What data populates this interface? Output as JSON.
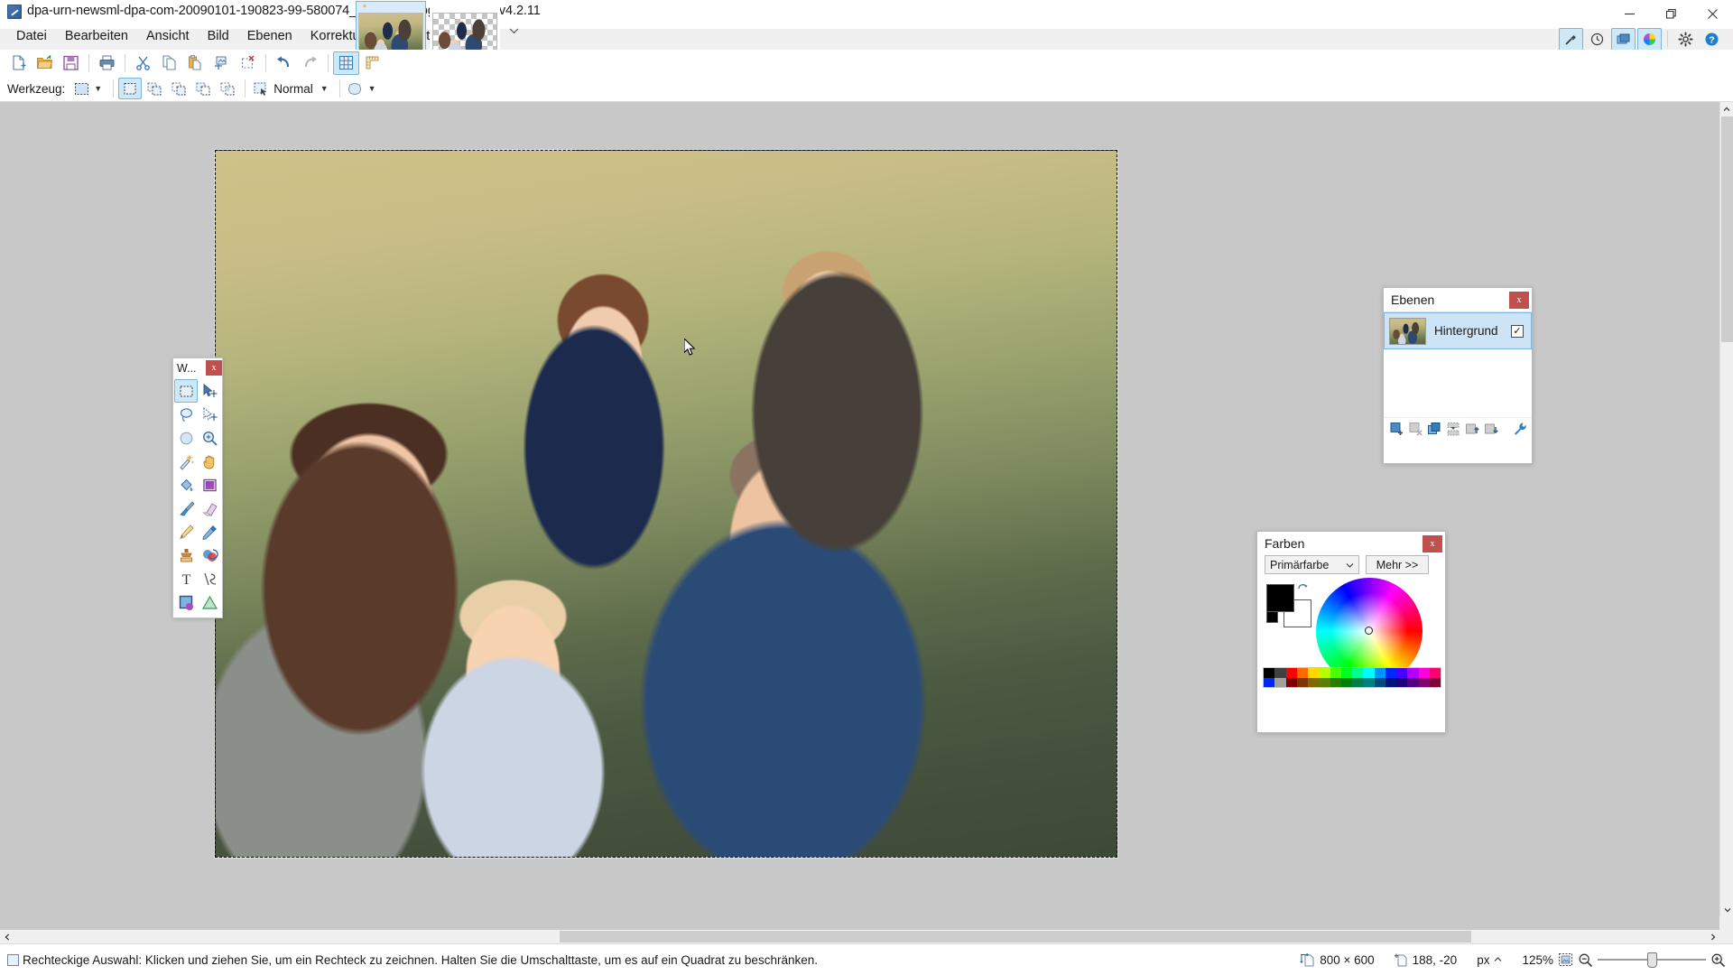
{
  "window": {
    "title": "dpa-urn-newsml-dpa-com-20090101-190823-99-580074_large_4_3.jpg - paint.net v4.2.11",
    "app_icon": "paintnet-icon",
    "controls": [
      {
        "name": "minimize-button",
        "glyph": "minimize-icon"
      },
      {
        "name": "maximize-button",
        "glyph": "maximize-icon"
      },
      {
        "name": "close-button",
        "glyph": "close-icon"
      }
    ]
  },
  "menubar": {
    "items": [
      {
        "label": "Datei",
        "name": "menu-datei"
      },
      {
        "label": "Bearbeiten",
        "name": "menu-bearbeiten"
      },
      {
        "label": "Ansicht",
        "name": "menu-ansicht"
      },
      {
        "label": "Bild",
        "name": "menu-bild"
      },
      {
        "label": "Ebenen",
        "name": "menu-ebenen"
      },
      {
        "label": "Korrekturen",
        "name": "menu-korrekturen"
      },
      {
        "label": "Effekte",
        "name": "menu-effekte"
      }
    ]
  },
  "document_tabs": {
    "tabs": [
      {
        "name": "document-tab-1",
        "active": true,
        "close_glyph": "*",
        "transparent": false
      },
      {
        "name": "document-tab-2",
        "active": false,
        "close_glyph": "",
        "transparent": true
      }
    ],
    "overflow_glyph": "chevron-down-icon"
  },
  "panel_toggles": [
    {
      "name": "tools-panel-toggle",
      "icon": "hammer-icon",
      "active": true
    },
    {
      "name": "history-panel-toggle",
      "icon": "history-clock-icon",
      "active": false
    },
    {
      "name": "layers-panel-toggle",
      "icon": "layers-icon",
      "active": true
    },
    {
      "name": "colors-panel-toggle",
      "icon": "color-wheel-icon",
      "active": true
    },
    {
      "name": "settings-button",
      "icon": "gear-icon",
      "active": false
    },
    {
      "name": "help-button",
      "icon": "help-question-icon",
      "active": false
    }
  ],
  "toolbar": {
    "buttons": [
      {
        "name": "new-button",
        "icon": "new-document-icon"
      },
      {
        "name": "open-button",
        "icon": "open-folder-icon"
      },
      {
        "name": "save-button",
        "icon": "floppy-save-icon"
      },
      {
        "name": "print-button",
        "icon": "printer-icon"
      },
      {
        "name": "cut-button",
        "icon": "scissors-icon"
      },
      {
        "name": "copy-button",
        "icon": "copy-icon"
      },
      {
        "name": "paste-button",
        "icon": "paste-icon"
      },
      {
        "name": "crop-to-selection-button",
        "icon": "crop-icon"
      },
      {
        "name": "deselect-button",
        "icon": "deselect-icon"
      },
      {
        "name": "undo-button",
        "icon": "undo-arrow-icon"
      },
      {
        "name": "redo-button",
        "icon": "redo-arrow-icon"
      },
      {
        "name": "grid-toggle-button",
        "icon": "grid-icon",
        "active": true
      },
      {
        "name": "rulers-toggle-button",
        "icon": "ruler-icon"
      }
    ]
  },
  "tool_options": {
    "label": "Werkzeug:",
    "active_tool_icon": "rectangle-select-icon",
    "selection_modes": [
      {
        "name": "selection-mode-replace",
        "icon": "sel-replace-icon",
        "active": true
      },
      {
        "name": "selection-mode-union",
        "icon": "sel-union-icon",
        "active": false
      },
      {
        "name": "selection-mode-exclude",
        "icon": "sel-exclude-icon",
        "active": false
      },
      {
        "name": "selection-mode-xor",
        "icon": "sel-xor-icon",
        "active": false
      },
      {
        "name": "selection-mode-intersect",
        "icon": "sel-intersect-icon",
        "active": false
      }
    ],
    "blend_label": "Normal",
    "blend_icon": "blend-mode-icon",
    "shape_icon": "antialias-shape-icon"
  },
  "tools_panel": {
    "title": "W...",
    "close_label": "x",
    "tools": [
      {
        "name": "tool-rectangle-select",
        "icon": "rectangle-select-icon",
        "active": true
      },
      {
        "name": "tool-move-selected",
        "icon": "move-selected-icon",
        "active": false
      },
      {
        "name": "tool-lasso-select",
        "icon": "lasso-select-icon",
        "active": false
      },
      {
        "name": "tool-move-selection",
        "icon": "move-selection-icon",
        "active": false
      },
      {
        "name": "tool-ellipse-select",
        "icon": "ellipse-select-icon",
        "active": false
      },
      {
        "name": "tool-zoom",
        "icon": "magnifier-zoom-icon",
        "active": false
      },
      {
        "name": "tool-magic-wand",
        "icon": "magic-wand-icon",
        "active": false
      },
      {
        "name": "tool-pan",
        "icon": "pan-hand-icon",
        "active": false
      },
      {
        "name": "tool-paint-bucket",
        "icon": "paint-bucket-icon",
        "active": false
      },
      {
        "name": "tool-gradient",
        "icon": "gradient-icon",
        "active": false
      },
      {
        "name": "tool-paintbrush",
        "icon": "paintbrush-icon",
        "active": false
      },
      {
        "name": "tool-eraser",
        "icon": "eraser-icon",
        "active": false
      },
      {
        "name": "tool-pencil",
        "icon": "pencil-icon",
        "active": false
      },
      {
        "name": "tool-color-picker",
        "icon": "eyedropper-icon",
        "active": false
      },
      {
        "name": "tool-clone-stamp",
        "icon": "clone-stamp-icon",
        "active": false
      },
      {
        "name": "tool-recolor",
        "icon": "recolor-icon",
        "active": false
      },
      {
        "name": "tool-text",
        "icon": "text-tool-icon",
        "active": false
      },
      {
        "name": "tool-line-curve",
        "icon": "line-curve-icon",
        "active": false
      },
      {
        "name": "tool-rectangle-shape",
        "icon": "rectangle-shape-icon",
        "active": false
      },
      {
        "name": "tool-shapes",
        "icon": "shapes-icon",
        "active": false
      }
    ]
  },
  "layers_panel": {
    "title": "Ebenen",
    "close_label": "x",
    "layers": [
      {
        "name": "Hintergrund",
        "visible": true,
        "checkmark": "✓",
        "selected": true
      }
    ],
    "footer_buttons": [
      {
        "name": "add-layer-button",
        "icon": "add-layer-icon"
      },
      {
        "name": "delete-layer-button",
        "icon": "delete-layer-icon"
      },
      {
        "name": "duplicate-layer-button",
        "icon": "duplicate-layer-icon"
      },
      {
        "name": "merge-layer-down-button",
        "icon": "merge-down-icon"
      },
      {
        "name": "move-layer-up-button",
        "icon": "move-layer-up-icon"
      },
      {
        "name": "move-layer-down-button",
        "icon": "move-layer-down-icon"
      },
      {
        "name": "layer-properties-button",
        "icon": "wrench-icon"
      }
    ]
  },
  "colors_panel": {
    "title": "Farben",
    "close_label": "x",
    "mode_select": "Primärfarbe",
    "mode_caret": "chevron-down-icon",
    "more_button": "Mehr >>",
    "primary_color": "#000000",
    "secondary_color": "#ffffff",
    "swap_icon": "swap-colors-icon",
    "wheel_icon": "color-wheel-icon",
    "palette_row1": [
      "#000000",
      "#404040",
      "#ff0000",
      "#ff6a00",
      "#ffd800",
      "#b6ff00",
      "#4cff00",
      "#00ff21",
      "#00ff90",
      "#00ffff",
      "#0094ff",
      "#0026ff",
      "#4800ff",
      "#b200ff",
      "#ff00dc",
      "#ff006e"
    ],
    "palette_row2": [
      "#0026ff",
      "#a0a0a0",
      "#7f0000",
      "#7f3300",
      "#7f6a00",
      "#5b7f00",
      "#267f00",
      "#007f0e",
      "#007f46",
      "#007f7f",
      "#004a7f",
      "#00137f",
      "#21007f",
      "#57007f",
      "#7f006e",
      "#7f0037"
    ]
  },
  "canvas": {
    "selection_active": true,
    "cursor_icon": "arrow-cursor-icon"
  },
  "scrollbars": {
    "vertical": {
      "up_glyph": "chevron-up-icon",
      "down_glyph": "chevron-down-icon"
    },
    "horizontal": {
      "left_glyph": "chevron-left-icon",
      "right_glyph": "chevron-right-icon"
    }
  },
  "statusbar": {
    "tool_icon": "rectangle-select-icon",
    "hint": "Rechteckige Auswahl: Klicken und ziehen Sie, um ein Rechteck zu zeichnen. Halten Sie die Umschalttaste, um es auf ein Quadrat zu beschränken.",
    "image_size_icon": "image-size-icon",
    "image_size": "800 × 600",
    "cursor_pos_icon": "cursor-position-icon",
    "cursor_position": "188, -20",
    "units": "px",
    "units_caret": "chevron-up-icon",
    "zoom_level": "125%",
    "fit_icon": "fit-to-window-icon",
    "zoom_out_icon": "zoom-out-icon",
    "zoom_in_icon": "zoom-in-icon"
  }
}
